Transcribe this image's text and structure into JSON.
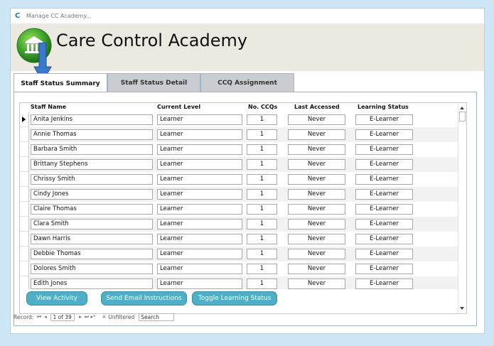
{
  "titlebar": {
    "title": "Manage CC Academy..."
  },
  "header": {
    "app_title": "Care Control Academy"
  },
  "tabs": [
    {
      "label": "Staff Status Summary"
    },
    {
      "label": "Staff Status Detail"
    },
    {
      "label": "CCQ Assignment"
    }
  ],
  "columns": {
    "staff_name": "Staff Name",
    "current_level": "Current Level",
    "no_ccqs": "No. CCQs",
    "last_accessed": "Last Accessed",
    "learning_status": "Learning Status"
  },
  "rows": [
    {
      "name": "Anita Jenkins",
      "level": "Learner",
      "ccqs": "1",
      "accessed": "Never",
      "status": "E-Learner"
    },
    {
      "name": "Annie Thomas",
      "level": "Learner",
      "ccqs": "1",
      "accessed": "Never",
      "status": "E-Learner"
    },
    {
      "name": "Barbara Smith",
      "level": "Learner",
      "ccqs": "1",
      "accessed": "Never",
      "status": "E-Learner"
    },
    {
      "name": "Brittany Stephens",
      "level": "Learner",
      "ccqs": "1",
      "accessed": "Never",
      "status": "E-Learner"
    },
    {
      "name": "Chrissy Smith",
      "level": "Learner",
      "ccqs": "1",
      "accessed": "Never",
      "status": "E-Learner"
    },
    {
      "name": "Cindy Jones",
      "level": "Learner",
      "ccqs": "1",
      "accessed": "Never",
      "status": "E-Learner"
    },
    {
      "name": "Claire Thomas",
      "level": "Learner",
      "ccqs": "1",
      "accessed": "Never",
      "status": "E-Learner"
    },
    {
      "name": "Clara Smith",
      "level": "Learner",
      "ccqs": "1",
      "accessed": "Never",
      "status": "E-Learner"
    },
    {
      "name": "Dawn Harris",
      "level": "Learner",
      "ccqs": "1",
      "accessed": "Never",
      "status": "E-Learner"
    },
    {
      "name": "Debbie Thomas",
      "level": "Learner",
      "ccqs": "1",
      "accessed": "Never",
      "status": "E-Learner"
    },
    {
      "name": "Dolores Smith",
      "level": "Learner",
      "ccqs": "1",
      "accessed": "Never",
      "status": "E-Learner"
    },
    {
      "name": "Edith Jones",
      "level": "Learner",
      "ccqs": "1",
      "accessed": "Never",
      "status": "E-Learner"
    }
  ],
  "buttons": {
    "view_activity": "View Activity",
    "send_email": "Send Email Instructions",
    "toggle_status": "Toggle Learning Status"
  },
  "navigation": {
    "record_label": "Record:",
    "first": "⏮",
    "prev": "◂",
    "position": "1 of 39",
    "next": "▸",
    "last": "⏭",
    "new": "▸*",
    "filter_label": "Unfiltered",
    "search_placeholder": "Search"
  },
  "colors": {
    "accent_button": "#4eafc7",
    "background": "#cde6f7",
    "header": "#ece9e1"
  },
  "icons": {
    "app": "app-c-icon",
    "logo": "academy-building-icon",
    "pointer": "blue-arrow-icon"
  }
}
